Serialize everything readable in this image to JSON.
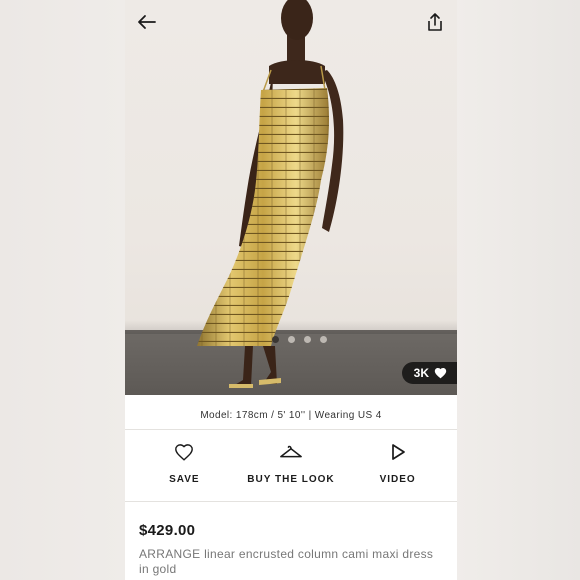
{
  "nav": {
    "back_icon": "arrow-left-icon",
    "share_icon": "share-icon"
  },
  "gallery": {
    "image_count": 4,
    "active_index": 0,
    "likes": "3K",
    "likes_icon": "heart-filled-icon"
  },
  "model_info": "Model: 178cm / 5' 10'' | Wearing US 4",
  "actions": [
    {
      "label": "SAVE",
      "icon": "heart-outline-icon"
    },
    {
      "label": "BUY THE LOOK",
      "icon": "hanger-icon"
    },
    {
      "label": "VIDEO",
      "icon": "play-icon"
    }
  ],
  "product": {
    "price": "$429.00",
    "name": "ARRANGE linear encrusted column cami maxi dress in gold"
  },
  "colors": {
    "accent_dark": "#1e1d1c",
    "dress_gold": "#c9a94a",
    "muted_text": "#777777"
  }
}
